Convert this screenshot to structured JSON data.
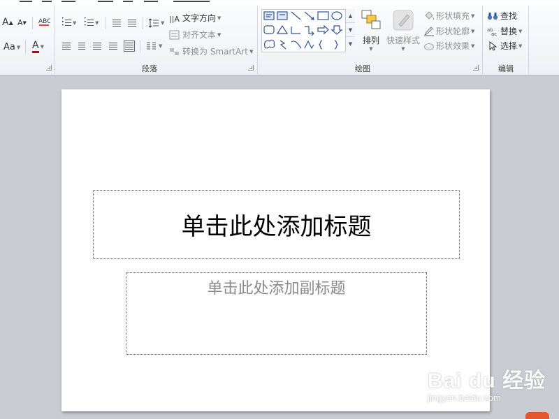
{
  "ribbon": {
    "font_group": {
      "grow_font": "A",
      "shrink_font": "A",
      "change_case": "Aa",
      "font_color": "A"
    },
    "paragraph_group": {
      "label": "段落",
      "text_direction": "文字方向",
      "align_text": "对齐文本",
      "convert_smartart": "转换为 SmartArt"
    },
    "drawing_group": {
      "label": "绘图",
      "arrange": "排列",
      "quick_styles": "快速样式",
      "shape_fill": "形状填充",
      "shape_outline": "形状轮廓",
      "shape_effects": "形状效果"
    },
    "editing_group": {
      "label": "编辑",
      "find": "查找",
      "replace": "替换",
      "select": "选择"
    }
  },
  "slide": {
    "title_placeholder": "单击此处添加标题",
    "subtitle_placeholder": "单击此处添加副标题"
  },
  "watermark": {
    "main": "Bai du 经验",
    "sub": "jingyan.baidu.com"
  },
  "colors": {
    "workspace": "#c9ccd3",
    "ribbon": "#f5f7fa",
    "subtitle_text": "#8a8a8a",
    "accent_orange": "#e4572e"
  }
}
